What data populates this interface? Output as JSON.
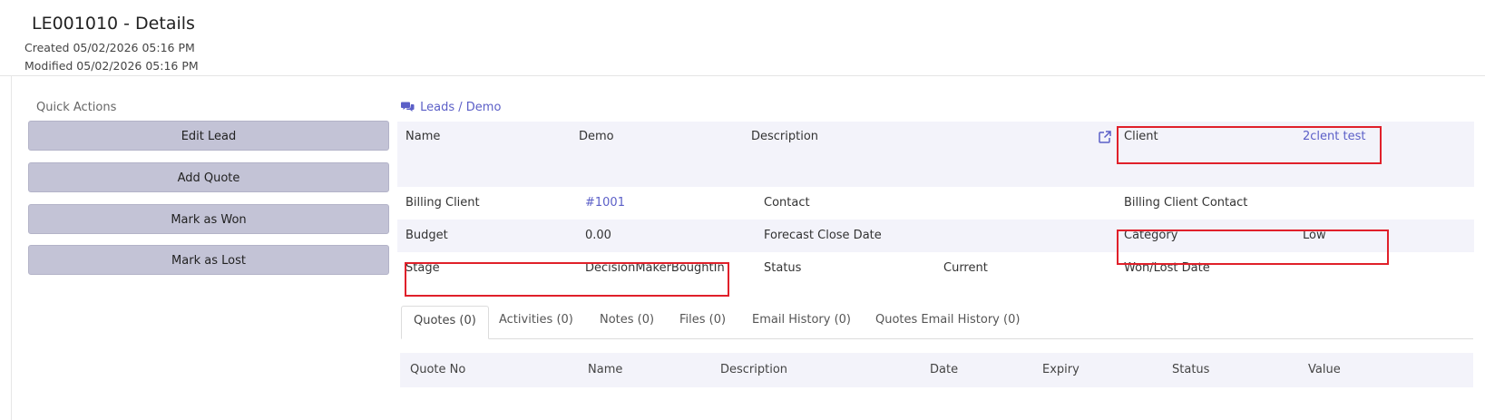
{
  "header": {
    "title": "LE001010 - Details",
    "created": "Created 05/02/2026 05:16 PM",
    "modified": "Modified 05/02/2026 05:16 PM"
  },
  "quick_actions": {
    "title": "Quick Actions",
    "buttons": [
      "Edit Lead",
      "Add Quote",
      "Mark as Won",
      "Mark as Lost"
    ]
  },
  "breadcrumb": {
    "icon": "comments-icon",
    "text": "Leads / Demo"
  },
  "details": {
    "name_label": "Name",
    "name_value": "Demo",
    "description_label": "Description",
    "client_label": "Client",
    "client_value": "2clent test",
    "billing_client_label": "Billing Client",
    "billing_client_value": "#1001",
    "contact_label": "Contact",
    "billing_client_contact_label": "Billing Client Contact",
    "budget_label": "Budget",
    "budget_value": "0.00",
    "forecast_close_date_label": "Forecast Close Date",
    "category_label": "Category",
    "category_value": "Low",
    "stage_label": "Stage",
    "stage_value": "DecisionMakerBoughtIn",
    "status_label": "Status",
    "status_value": "Current",
    "won_lost_date_label": "Won/Lost Date"
  },
  "tabs": [
    "Quotes (0)",
    "Activities (0)",
    "Notes (0)",
    "Files (0)",
    "Email History (0)",
    "Quotes Email History (0)"
  ],
  "quotes_table": {
    "columns": [
      "Quote No",
      "Name",
      "Description",
      "Date",
      "Expiry",
      "Status",
      "Value"
    ]
  },
  "colors": {
    "accent": "#5b5fc7",
    "button_bg": "#c3c3d6",
    "row_shade": "#f3f3fa",
    "highlight": "#e0202a"
  }
}
